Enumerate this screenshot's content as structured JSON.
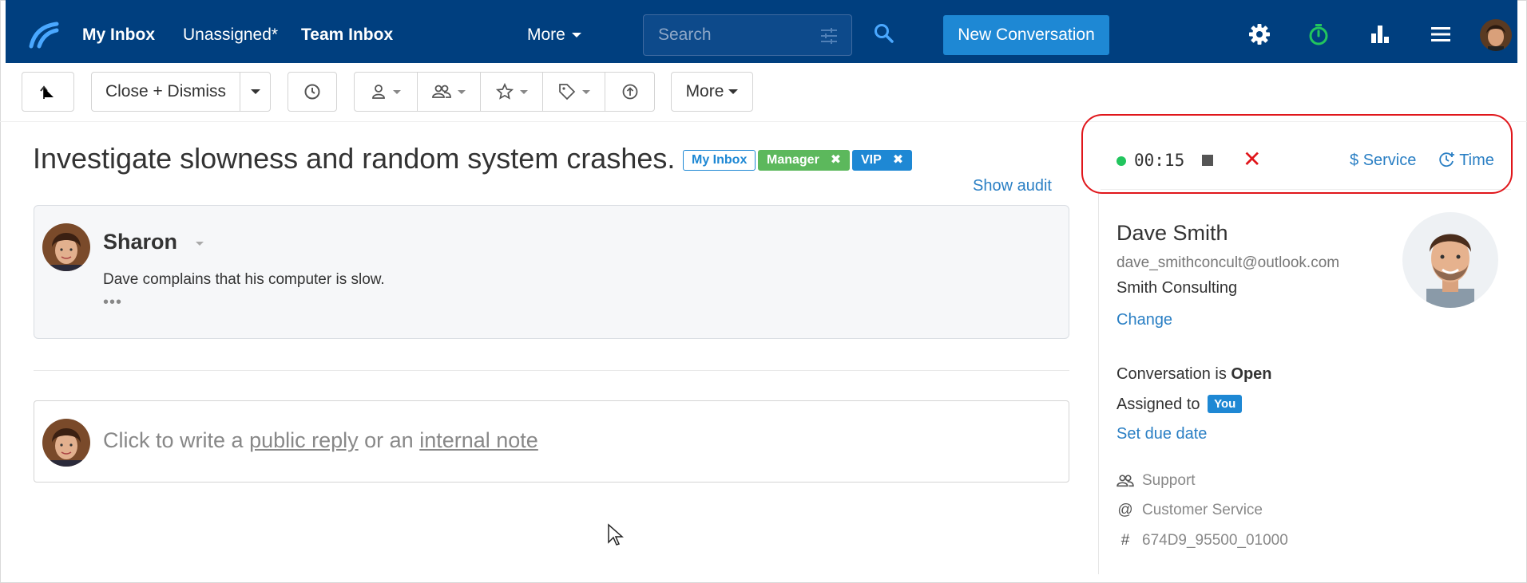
{
  "nav": {
    "my_inbox": "My Inbox",
    "unassigned": "Unassigned*",
    "team_inbox": "Team Inbox",
    "more": "More",
    "search_placeholder": "Search",
    "new_conversation": "New Conversation",
    "icons": [
      "logo-icon",
      "filter-icon",
      "search-icon",
      "gear-icon",
      "stopwatch-icon",
      "bar-chart-icon",
      "menu-icon"
    ]
  },
  "toolbar": {
    "close_dismiss": "Close + Dismiss",
    "more": "More"
  },
  "conversation": {
    "title": "Investigate slowness and random system crashes.",
    "tags": [
      {
        "label": "My Inbox"
      },
      {
        "label": "Manager"
      },
      {
        "label": "VIP"
      }
    ],
    "show_audit": "Show audit",
    "message": {
      "author": "Sharon",
      "body": "Dave complains that his computer is slow.",
      "ellipsis": "•••"
    },
    "reply": {
      "prefix": "Click to write a",
      "public_reply": "public reply",
      "or": "or an",
      "internal_note": "internal note"
    }
  },
  "timer": {
    "elapsed": "00:15",
    "service": "Service",
    "time": "Time",
    "close": "✕"
  },
  "contact": {
    "name": "Dave Smith",
    "email": "dave_smithconcult@outlook.com",
    "company": "Smith Consulting",
    "change": "Change"
  },
  "status": {
    "prefix": "Conversation is",
    "state": "Open",
    "assigned_prefix": "Assigned to",
    "assigned_to": "You",
    "due_date": "Set due date"
  },
  "meta": {
    "team": "Support",
    "mailbox": "Customer Service",
    "ticket_id": "674D9_95500_01000"
  },
  "colors": {
    "nav_bg": "#003f7f",
    "primary": "#1e88d4",
    "link": "#2a7fc4",
    "manager_tag": "#5cb85c",
    "highlight_ring": "#e0161b",
    "timer_dot": "#22c55e"
  }
}
